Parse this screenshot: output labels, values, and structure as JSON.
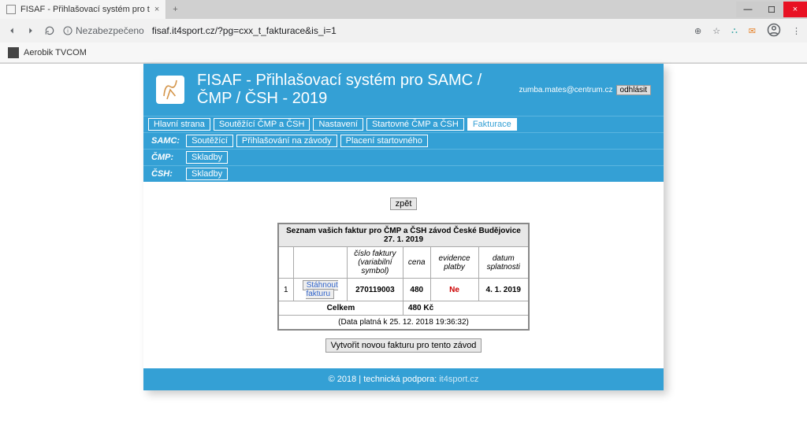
{
  "browser": {
    "tab_title": "FISAF - Přihlašovací systém pro t",
    "security": "Nezabezpečeno",
    "url": "fisaf.it4sport.cz/?pg=cxx_t_fakturace&is_i=1",
    "bookmark": "Aerobik TVCOM"
  },
  "header": {
    "title": "FISAF - Přihlašovací systém pro SAMC / ČMP / ČSH - 2019",
    "email": "zumba.mates@centrum.cz",
    "logout": "odhlásit"
  },
  "nav": {
    "row1": [
      "Hlavní strana",
      "Soutěžící ČMP a ČSH",
      "Nastavení",
      "Startovné ČMP a ČSH",
      "Fakturace"
    ],
    "active_idx": 4,
    "samc_label": "SAMC:",
    "samc": [
      "Soutěžící",
      "Přihlašování na závody",
      "Placení startovného"
    ],
    "cmp_label": "ČMP:",
    "cmp": [
      "Skladby"
    ],
    "csh_label": "ČSH:",
    "csh": [
      "Skladby"
    ]
  },
  "content": {
    "back": "zpět",
    "table_title": "Seznam vašich faktur pro ČMP a ČSH závod České Budějovice 27. 1. 2019",
    "cols": {
      "c1": "číslo faktury",
      "c1sub": "(variabilní symbol)",
      "c2": "cena",
      "c3": "evidence platby",
      "c4": "datum splatnosti"
    },
    "rows": [
      {
        "idx": "1",
        "action": "Stáhnout fakturu",
        "num": "270119003",
        "price": "480",
        "paid": "Ne",
        "due": "4. 1. 2019"
      }
    ],
    "total_label": "Celkem",
    "total_value": "480 Kč",
    "data_note": "(Data platná k 25. 12. 2018 19:36:32)",
    "create": "Vytvořit novou fakturu pro tento závod"
  },
  "footer": {
    "text": "© 2018 | technická podpora: ",
    "link": "it4sport.cz"
  }
}
